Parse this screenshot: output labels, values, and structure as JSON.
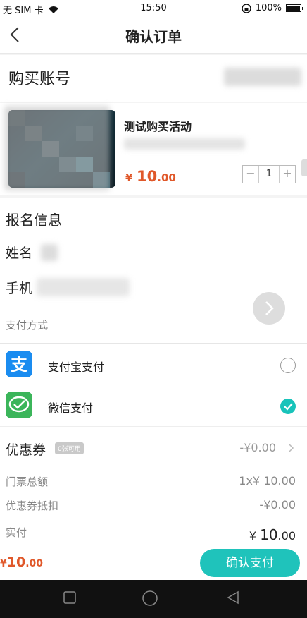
{
  "status_bar": {
    "carrier": "无 SIM 卡",
    "time": "15:50",
    "battery": "100%"
  },
  "nav": {
    "title": "确认订单"
  },
  "account": {
    "heading": "购买账号"
  },
  "product": {
    "name": "测试购买活动",
    "price_symbol": "¥",
    "price_int": "10",
    "price_dec": ".00",
    "quantity": "1",
    "minus": "−",
    "plus": "+"
  },
  "signup": {
    "heading": "报名信息",
    "name_label": "姓名",
    "phone_label": "手机",
    "payment_method_label": "支付方式"
  },
  "payment": {
    "options": [
      {
        "label": "支付宝支付",
        "icon": "alipay-icon",
        "color": "#1a8cf0",
        "selected": false
      },
      {
        "label": "微信支付",
        "icon": "wechat-pay-icon",
        "color": "#3bb55a",
        "selected": true
      }
    ]
  },
  "coupon": {
    "label": "优惠券",
    "badge": "0张可用",
    "value": "-¥0.00"
  },
  "summary": {
    "ticket_total_label": "门票总额",
    "ticket_total_value": "1x¥ 10.00",
    "coupon_discount_label": "优惠券抵扣",
    "coupon_discount_value": "-¥0.00",
    "paid_label": "实付",
    "paid_symbol": "¥ ",
    "paid_int": "10",
    "paid_dec": ".00"
  },
  "bottom": {
    "total_symbol": "¥",
    "total_int": "10",
    "total_dec": ".00",
    "confirm_label": "确认支付"
  },
  "colors": {
    "accent": "#1fc3bb",
    "price": "#e0582a",
    "check": "#18c3ba"
  }
}
